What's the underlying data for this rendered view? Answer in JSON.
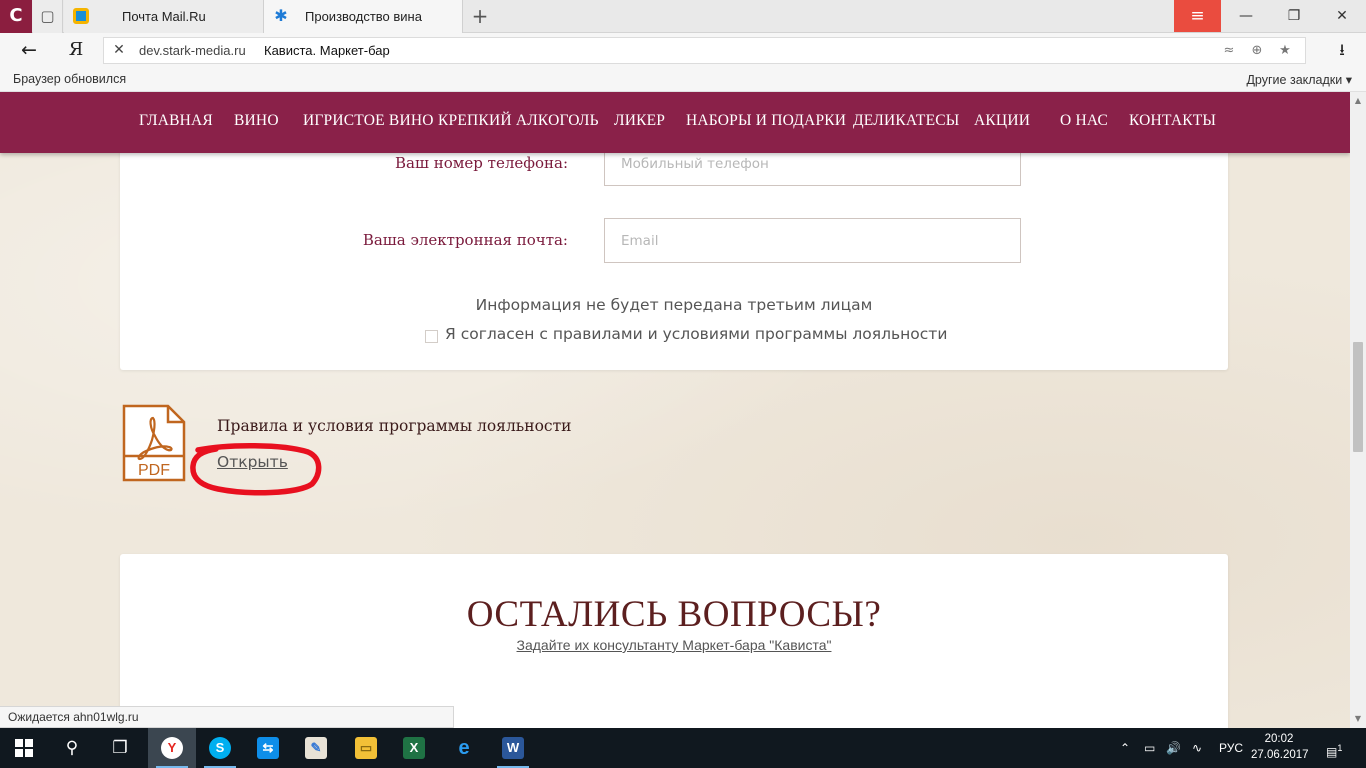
{
  "browser": {
    "corner_logo": "С",
    "tabs": [
      {
        "title": "Почта Mail.Ru"
      },
      {
        "title": "Производство вина"
      }
    ],
    "new_tab": "+",
    "menu_glyph": "≡",
    "back_glyph": "←",
    "yandex_glyph": "Я",
    "stop_glyph": "✕",
    "url_domain": "dev.stark-media.ru",
    "url_title": "Кависта. Маркет-бар",
    "download_glyph": "⭳",
    "bookmarks_left": "Браузер обновился",
    "bookmarks_right": "Другие закладки ▾",
    "status_text": "Ожидается ahn01wlg.ru"
  },
  "site_nav": {
    "items": [
      "ГЛАВНАЯ",
      "ВИНО",
      "ИГРИСТОЕ ВИНО",
      "КРЕПКИЙ АЛКОГОЛЬ",
      "ЛИКЕР",
      "НАБОРЫ И ПОДАРКИ",
      "ДЕЛИКАТЕСЫ",
      "АКЦИИ",
      "О НАС",
      "КОНТАКТЫ"
    ]
  },
  "form": {
    "phone_label": "Ваш номер телефона:",
    "phone_placeholder": "Мобильный телефон",
    "email_label": "Ваша электронная почта:",
    "email_placeholder": "Email",
    "privacy_note": "Информация не будет передана третьим лицам",
    "agree_label": "Я согласен с правилами и условиями программы лояльности",
    "agree_checked": false
  },
  "document": {
    "icon_text": "PDF",
    "title": "Правила и условия программы лояльности",
    "open_link": "Открыть",
    "highlight_color": "#e8101f"
  },
  "questions": {
    "title": "ОСТАЛИСЬ ВОПРОСЫ?",
    "subtitle": "Задайте их консультанту Маркет-бара \"Кависта\""
  },
  "taskbar": {
    "language": "РУС",
    "time": "20:02",
    "date": "27.06.2017",
    "notification_count": "1"
  },
  "colors": {
    "nav_bg": "#8a2149",
    "label_color": "#7a1a3c",
    "title_color": "#5c1f1f",
    "pdf_icon": "#c0661f",
    "browser_menu": "#ea4c3f"
  }
}
